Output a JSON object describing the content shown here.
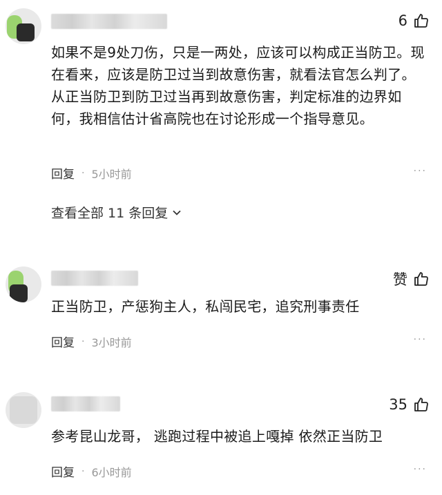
{
  "comments": [
    {
      "likes": "6",
      "text": "如果不是9处刀伤，只是一两处，应该可以构成正当防卫。现在看来，应该是防卫过当到故意伤害，就看法官怎么判了。从正当防卫到防卫过当再到故意伤害，判定标准的边界如何，我相信估计省高院也在讨论形成一个指导意见。",
      "reply_label": "回复",
      "separator": "·",
      "time": "5小时前",
      "view_replies": "查看全部 11 条回复"
    },
    {
      "likes": "赞",
      "text": "正当防卫，产惩狗主人，私闯民宅，追究刑事责任",
      "reply_label": "回复",
      "separator": "·",
      "time": "3小时前"
    },
    {
      "likes": "35",
      "text": "参考昆山龙哥， 逃跑过程中被追上嘎掉 依然正当防卫",
      "reply_label": "回复",
      "separator": "·",
      "time": "6小时前"
    }
  ],
  "icons": {
    "like": "thumbs-up-icon",
    "more": "more-dots-icon",
    "expand": "chevron-down-icon"
  },
  "colors": {
    "text": "#1a1a1a",
    "meta": "#999999",
    "avatar_accent": "#9bd36f"
  }
}
